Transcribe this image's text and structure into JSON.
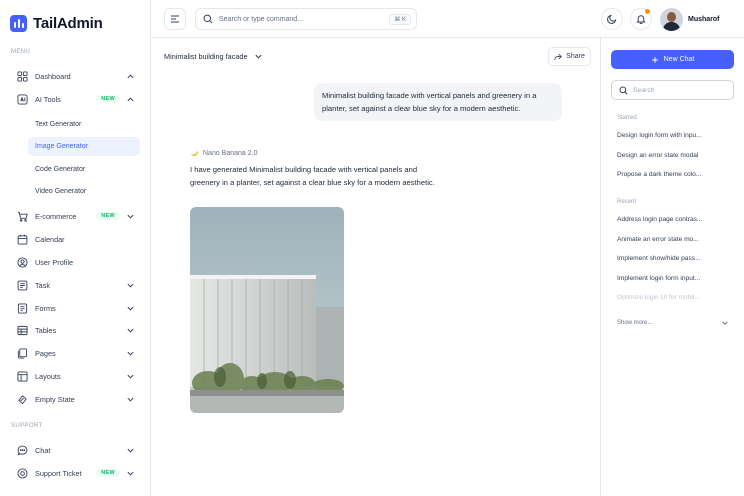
{
  "app": {
    "name": "TailAdmin",
    "brand_color": "#465fff"
  },
  "sidebar": {
    "menu_label": "MENU",
    "support_label": "SUPPORT",
    "items": [
      {
        "label": "Dashboard",
        "icon": "grid-icon",
        "badge": "",
        "chevron": "up"
      },
      {
        "label": "AI Tools",
        "icon": "ai-sparkle-icon",
        "badge": "NEW",
        "chevron": "up"
      },
      {
        "label": "E-commerce",
        "icon": "cart-icon",
        "badge": "NEW",
        "chevron": "down"
      },
      {
        "label": "Calendar",
        "icon": "calendar-icon",
        "badge": "",
        "chevron": ""
      },
      {
        "label": "User Profile",
        "icon": "user-circle-icon",
        "badge": "",
        "chevron": ""
      },
      {
        "label": "Task",
        "icon": "task-icon",
        "badge": "",
        "chevron": "down"
      },
      {
        "label": "Forms",
        "icon": "forms-icon",
        "badge": "",
        "chevron": "down"
      },
      {
        "label": "Tables",
        "icon": "table-icon",
        "badge": "",
        "chevron": "down"
      },
      {
        "label": "Pages",
        "icon": "pages-icon",
        "badge": "",
        "chevron": "down"
      },
      {
        "label": "Layouts",
        "icon": "layouts-icon",
        "badge": "",
        "chevron": "down"
      },
      {
        "label": "Empty State",
        "icon": "empty-state-icon",
        "badge": "",
        "chevron": "down"
      }
    ],
    "ai_subitems": [
      "Text Generator",
      "Image Generator",
      "Code Generator",
      "Video Generator"
    ],
    "active_subitem": "Image Generator",
    "support_items": [
      {
        "label": "Chat",
        "icon": "chat-icon",
        "badge": "",
        "chevron": "down"
      },
      {
        "label": "Support Ticket",
        "icon": "ticket-icon",
        "badge": "NEW",
        "chevron": "down"
      }
    ]
  },
  "header": {
    "search_placeholder": "Search or type command...",
    "shortcut": "⌘ K",
    "user_name": "Musharof"
  },
  "chat": {
    "title": "Minimalist building facade",
    "share_label": "Share",
    "user_message": "Minimalist building facade with vertical panels and greenery in a planter, set against a clear blue sky for a modern aesthetic.",
    "model_label": "Nano Banana 2.0",
    "bot_message": "I have generated Minimalist building facade with vertical panels and greenery in a planter, set against a clear blue sky for a modern aesthetic."
  },
  "right_panel": {
    "new_chat_label": "New Chat",
    "search_placeholder": "Search",
    "starred_label": "Starred",
    "starred": [
      "Design login form with inpu...",
      "Design an error state modal",
      "Propose a dark theme colo..."
    ],
    "recent_label": "Recent",
    "recent": [
      "Address login page contras...",
      "Animate an error state mo...",
      "Implement show/hide pass...",
      "Implement login form input...",
      "Optimize login UI for mobil..."
    ],
    "show_more_label": "Show more..."
  }
}
